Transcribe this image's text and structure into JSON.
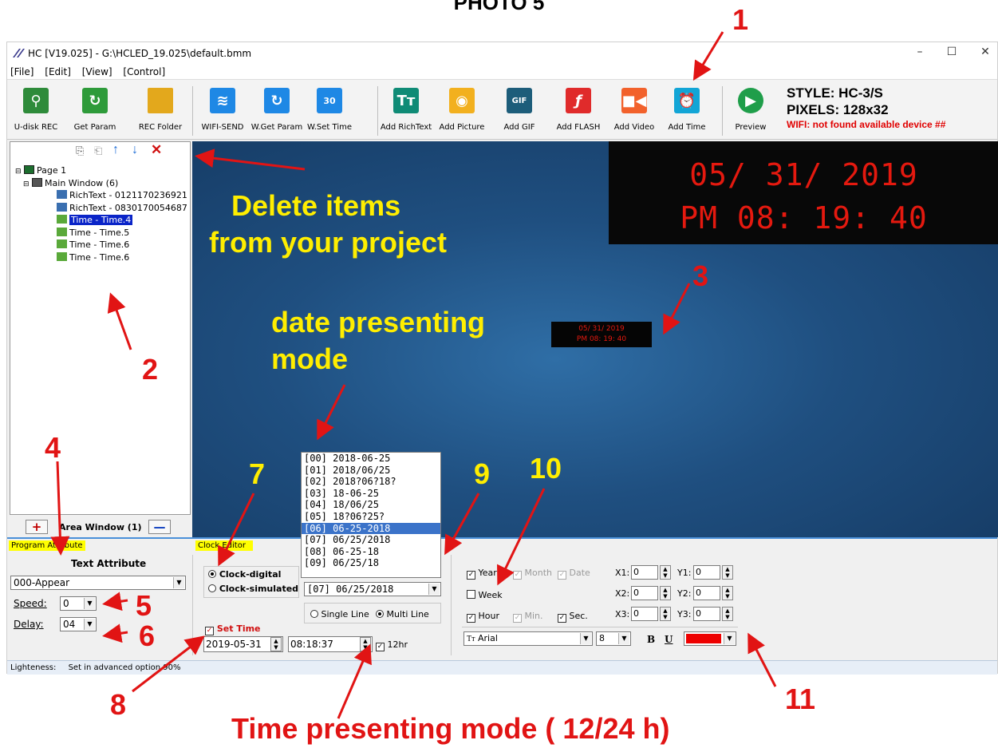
{
  "caption": "PHOTO 5",
  "window": {
    "title": "HC [V19.025] - G:\\HCLED_19.025\\default.bmm",
    "controls": [
      "–",
      "☐",
      "✕"
    ]
  },
  "menu": [
    "[File]",
    "[Edit]",
    "[View]",
    "[Control]"
  ],
  "toolbar": {
    "buttons": [
      {
        "label": "U-disk REC",
        "icon": "usb-icon",
        "color": "#2e8b3a"
      },
      {
        "label": "Get Param",
        "icon": "refresh-icon",
        "color": "#2e9b3a"
      },
      {
        "label": "REC Folder",
        "icon": "folder-icon",
        "color": "#e3a81c"
      },
      {
        "label": "WIFI-SEND",
        "icon": "wifi-icon",
        "color": "#1e88e5"
      },
      {
        "label": "W.Get Param",
        "icon": "refresh-icon",
        "color": "#1e88e5"
      },
      {
        "label": "W.Set Time",
        "icon": "timer-30-icon",
        "color": "#1e88e5"
      },
      {
        "label": "Add RichText",
        "icon": "richtext-icon",
        "color": "#0f8b76"
      },
      {
        "label": "Add Picture",
        "icon": "add-picture-icon",
        "color": "#f2b01e"
      },
      {
        "label": "Add GIF",
        "icon": "gif-icon",
        "color": "#1d5d7a"
      },
      {
        "label": "Add FLASH",
        "icon": "flash-icon",
        "color": "#e02b2b"
      },
      {
        "label": "Add Video",
        "icon": "video-icon",
        "color": "#f2612b"
      },
      {
        "label": "Add Time",
        "icon": "alarm-clock-icon",
        "color": "#12a5d6"
      },
      {
        "label": "Preview",
        "icon": "play-icon",
        "color": "#1f9e4a"
      }
    ],
    "style_line": "STYLE: HC-3/S",
    "pixels_line": "PIXELS: 128x32",
    "wifi_line": "WIFI:  not found available device ##"
  },
  "tree": {
    "items": [
      "Page 1",
      "Main Window  (6)",
      "RichText - 0121170236921",
      "RichText - 0830170054687",
      "Time - Time.4",
      "Time - Time.5",
      "Time - Time.6",
      "Time - Time.6"
    ],
    "area_window": "Area Window (1)"
  },
  "canvas": {
    "led_date": "05/ 31/ 2019",
    "led_time": "PM 08: 19: 40",
    "mini_date": "05/ 31/ 2019",
    "mini_time": "PM 08: 19: 40"
  },
  "tabs": {
    "program_attribute": "Program Attribute",
    "clock_editor": "Clock Editor"
  },
  "text_attribute": {
    "heading": "Text Attribute",
    "effect": "000-Appear",
    "speed_label": "Speed:",
    "speed": "0",
    "delay_label": "Delay:",
    "delay": "04"
  },
  "clock": {
    "digital": "Clock-digital",
    "simulated": "Clock-simulated",
    "format_selected": "[07]  06/25/2018",
    "single_line": "Single Line",
    "multi_line": "Multi Line",
    "set_time": "Set Time",
    "date_value": "2019-05-31",
    "time_value": "08:18:37",
    "hr12": "12hr",
    "format_options": [
      "[00]  2018-06-25",
      "[01]  2018/06/25",
      "[02]  2018?06?18?",
      "[03]  18-06-25",
      "[04]  18/06/25",
      "[05]  18?06?25?",
      "[06]  06-25-2018",
      "[07]  06/25/2018",
      "[08]  06-25-18",
      "[09]  06/25/18"
    ],
    "highlighted_index": 6
  },
  "fields": {
    "year": "Year",
    "month": "Month",
    "date": "Date",
    "week": "Week",
    "hour": "Hour",
    "min": "Min.",
    "sec": "Sec.",
    "x1": "X1:",
    "y1": "Y1:",
    "x2": "X2:",
    "y2": "Y2:",
    "x3": "X3:",
    "y3": "Y3:",
    "x1v": "0",
    "y1v": "0",
    "x2v": "0",
    "y2v": "0",
    "x3v": "0",
    "y3v": "0",
    "font": "Arial",
    "font_size": "8",
    "bold": "B",
    "underline": "U",
    "color": "#ee0000"
  },
  "status": {
    "lightness_label": "Lighteness:",
    "lightness_value": "Set in advanced option  90%"
  },
  "annotations": {
    "n1": "1",
    "n2": "2",
    "n3": "3",
    "n4": "4",
    "n5": "5",
    "n6": "6",
    "n7": "7",
    "n8": "8",
    "n9": "9",
    "n10": "10",
    "n11": "11",
    "delete_line1": "Delete items",
    "delete_line2": "from your project",
    "date_mode_line1": "date presenting",
    "date_mode_line2": "mode",
    "time_mode": "Time presenting mode ( 12/24 h)"
  }
}
